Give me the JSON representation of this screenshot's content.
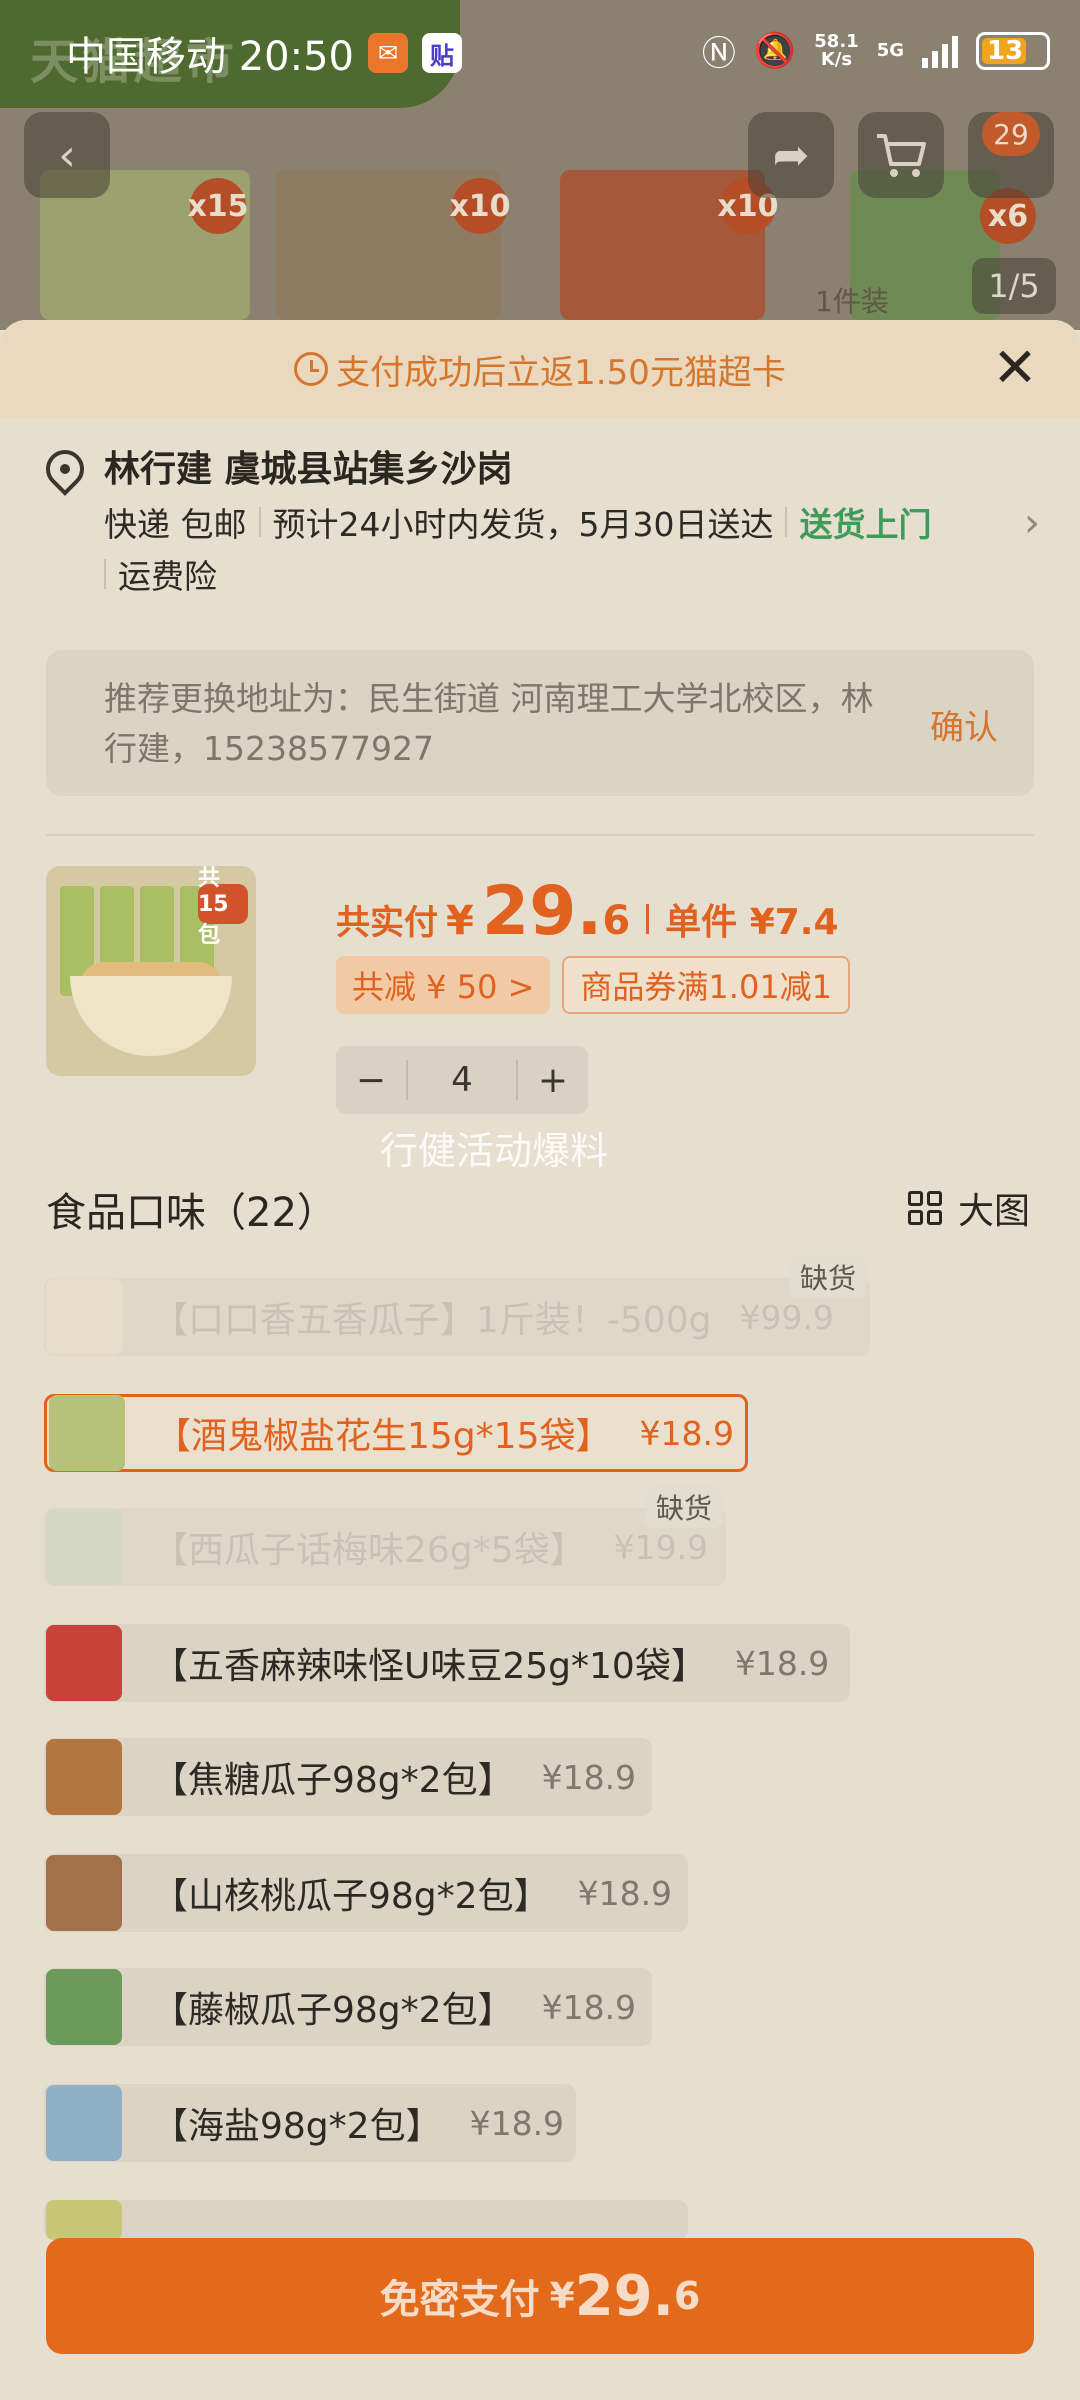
{
  "status_bar": {
    "carrier_time": "中国移动 20:50",
    "app_icon_1": "taobao-red-envelope-icon",
    "app_icon_2": "贴",
    "net_speed": "58.1",
    "net_unit": "K/s",
    "network": "5G",
    "battery": "13"
  },
  "background_page": {
    "banner_text": "天猫超市",
    "cart_badge": "29",
    "thumb_badges": [
      "x15",
      "x10",
      "x10",
      "x6"
    ],
    "caption": "1件装",
    "pager": "1/5"
  },
  "promo": {
    "text": "支付成功后立返1.50元猫超卡"
  },
  "address": {
    "name_line": "林行建 虞城县站集乡沙岗",
    "shipping": "快递 包邮",
    "delivery": "预计24小时内发货，5月30日送达",
    "door": "送货上门",
    "insurance": "运费险"
  },
  "suggest": {
    "text": "推荐更换地址为：民生街道 河南理工大学北校区，林行建，15238577927",
    "confirm": "确认"
  },
  "product": {
    "img_tag": "共15包",
    "total_label": "共实付",
    "yen": "¥",
    "price_int": "29.",
    "price_dec": "6",
    "unit_label": "单件 ¥7.4",
    "discount_chip": "共减 ¥ 50 >",
    "coupon_chip": "商品券满1.01减1",
    "quantity": "4",
    "minus": "−",
    "plus": "+"
  },
  "watermark": "行健活动爆料",
  "flavors": {
    "title": "食品口味（22）",
    "view_label": "大图",
    "out_of_stock": "缺货",
    "items": [
      {
        "name": "【口口香五香瓜子】1斤装！-500g",
        "price": "¥99.9"
      },
      {
        "name": "【酒鬼椒盐花生15g*15袋】",
        "price": "¥18.9"
      },
      {
        "name": "【西瓜子话梅味26g*5袋】",
        "price": "¥19.9"
      },
      {
        "name": "【五香麻辣味怪U味豆25g*10袋】",
        "price": "¥18.9"
      },
      {
        "name": "【焦糖瓜子98g*2包】",
        "price": "¥18.9"
      },
      {
        "name": "【山核桃瓜子98g*2包】",
        "price": "¥18.9"
      },
      {
        "name": "【藤椒瓜子98g*2包】",
        "price": "¥18.9"
      },
      {
        "name": "【海盐98g*2包】",
        "price": "¥18.9"
      }
    ]
  },
  "pay": {
    "label": "免密支付",
    "yen": "¥",
    "int": "29.",
    "dec": "6"
  },
  "colors": {
    "accent": "#e0621e",
    "pay_button": "#e3691b",
    "green": "#3f9b5a"
  }
}
